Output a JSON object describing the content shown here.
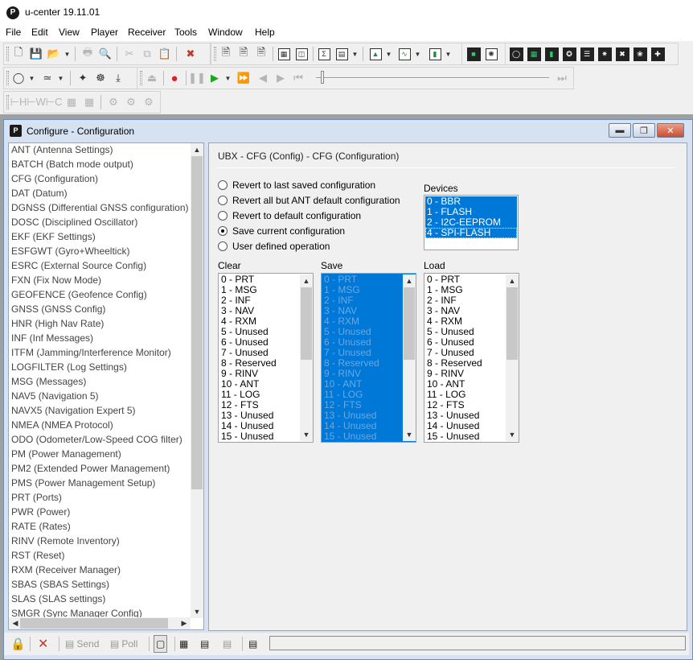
{
  "app": {
    "title": "u-center 19.11.01",
    "logo_letter": "P"
  },
  "menu": [
    "File",
    "Edit",
    "View",
    "Player",
    "Receiver",
    "Tools",
    "Window",
    "Help"
  ],
  "configure": {
    "window_title": "Configure - Configuration",
    "sidebar_items": [
      "ANT (Antenna Settings)",
      "BATCH (Batch mode output)",
      "CFG (Configuration)",
      "DAT (Datum)",
      "DGNSS (Differential GNSS configuration)",
      "DOSC (Disciplined Oscillator)",
      "EKF (EKF Settings)",
      "ESFGWT (Gyro+Wheeltick)",
      "ESRC (External Source Config)",
      "FXN (Fix Now Mode)",
      "GEOFENCE (Geofence Config)",
      "GNSS (GNSS Config)",
      "HNR (High Nav Rate)",
      "INF (Inf Messages)",
      "ITFM (Jamming/Interference Monitor)",
      "LOGFILTER (Log Settings)",
      "MSG (Messages)",
      "NAV5 (Navigation 5)",
      "NAVX5 (Navigation Expert 5)",
      "NMEA (NMEA Protocol)",
      "ODO (Odometer/Low-Speed COG filter)",
      "PM (Power Management)",
      "PM2 (Extended Power Management)",
      "PMS (Power Management Setup)",
      "PRT (Ports)",
      "PWR (Power)",
      "RATE (Rates)",
      "RINV (Remote Inventory)",
      "RST (Reset)",
      "RXM (Receiver Manager)",
      "SBAS (SBAS Settings)",
      "SLAS (SLAS settings)",
      "SMGR (Sync Manager Config)"
    ],
    "panel_title": "UBX - CFG (Config) - CFG (Configuration)",
    "radio_options": [
      {
        "label": "Revert to last saved configuration",
        "checked": false
      },
      {
        "label": "Revert all but ANT default configuration",
        "checked": false
      },
      {
        "label": "Revert to default configuration",
        "checked": false
      },
      {
        "label": "Save current configuration",
        "checked": true
      },
      {
        "label": "User defined operation",
        "checked": false
      }
    ],
    "devices_label": "Devices",
    "devices": [
      "0 - BBR",
      "1 - FLASH",
      "2 - I2C-EEPROM",
      "4 - SPI-FLASH"
    ],
    "clear_label": "Clear",
    "save_label": "Save",
    "load_label": "Load",
    "sections": [
      "0 - PRT",
      "1 - MSG",
      "2 - INF",
      "3 - NAV",
      "4 - RXM",
      "5 - Unused",
      "6 - Unused",
      "7 - Unused",
      "8 - Reserved",
      "9 - RINV",
      "10 - ANT",
      "11 - LOG",
      "12 - FTS",
      "13 - Unused",
      "14 - Unused",
      "15 - Unused"
    ],
    "bottom": {
      "send_label": "Send",
      "poll_label": "Poll"
    }
  },
  "colors": {
    "selection": "#0078d7",
    "window_frame": "#d6e2f1"
  }
}
